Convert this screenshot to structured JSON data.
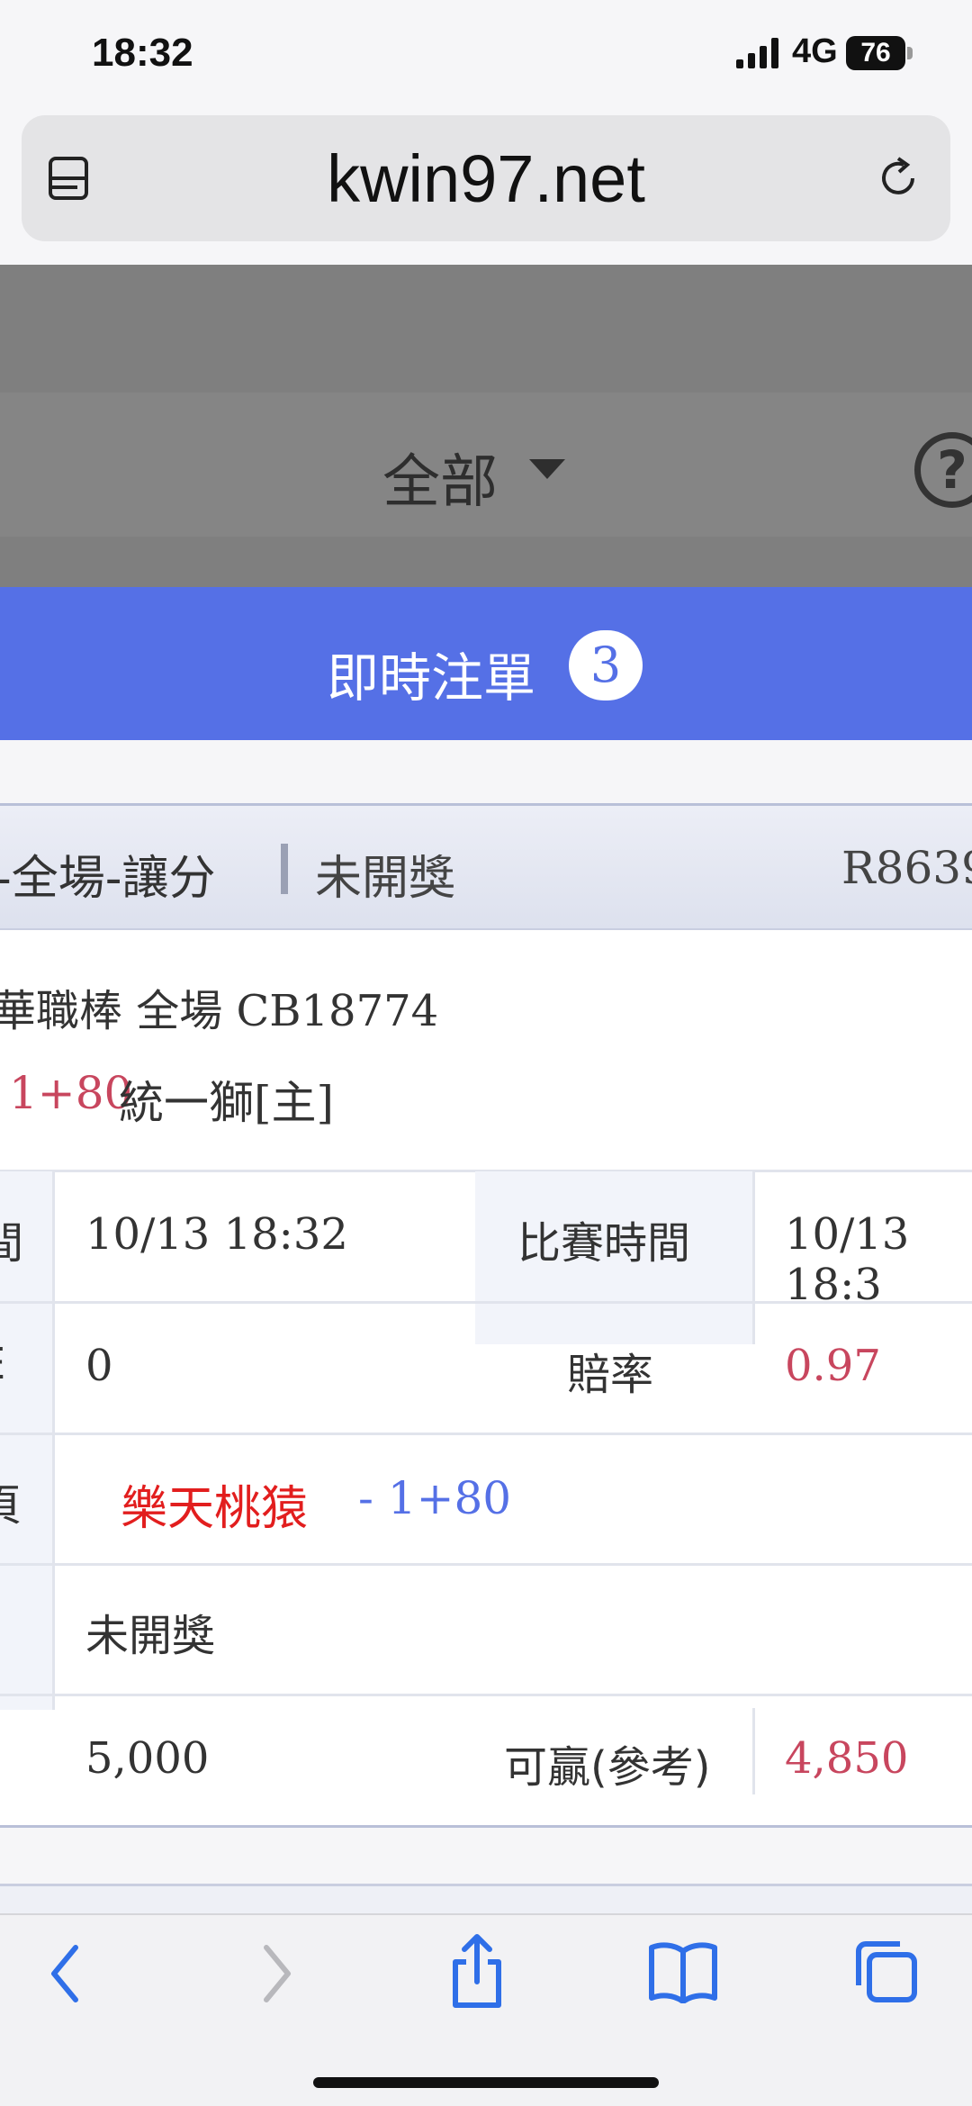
{
  "status_bar": {
    "time": "18:32",
    "network": "4G",
    "battery": "76"
  },
  "browser": {
    "url": "kwin97.net"
  },
  "header": {
    "filter_label": "全部",
    "help_symbol": "?"
  },
  "tab": {
    "label": "即時注單",
    "count": "3"
  },
  "bet": {
    "type": "-全場-讓分",
    "status": "未開獎",
    "order_no": "R8639",
    "league_line": "華職棒 全場 CB18774",
    "handicap": "1+80",
    "main_team": "統一獅[主]",
    "rows": {
      "time_label_fragment": "間",
      "order_time": "10/13 18:32",
      "match_time_label": "比賽時間",
      "match_time": "10/13 18:3",
      "stake_label_fragment": "E",
      "stake_zero": "0",
      "odds_label": "賠率",
      "odds": "0.97",
      "pick_label_fragment": "頁",
      "pick_team": "樂天桃猿",
      "pick_line": "- 1+80",
      "result": "未開獎",
      "amount": "5,000",
      "win_label": "可贏(參考)",
      "win_amount": "4,850"
    }
  },
  "colors": {
    "accent": "#5570e6",
    "danger": "#e21e1e",
    "highlight": "#c8465e"
  }
}
